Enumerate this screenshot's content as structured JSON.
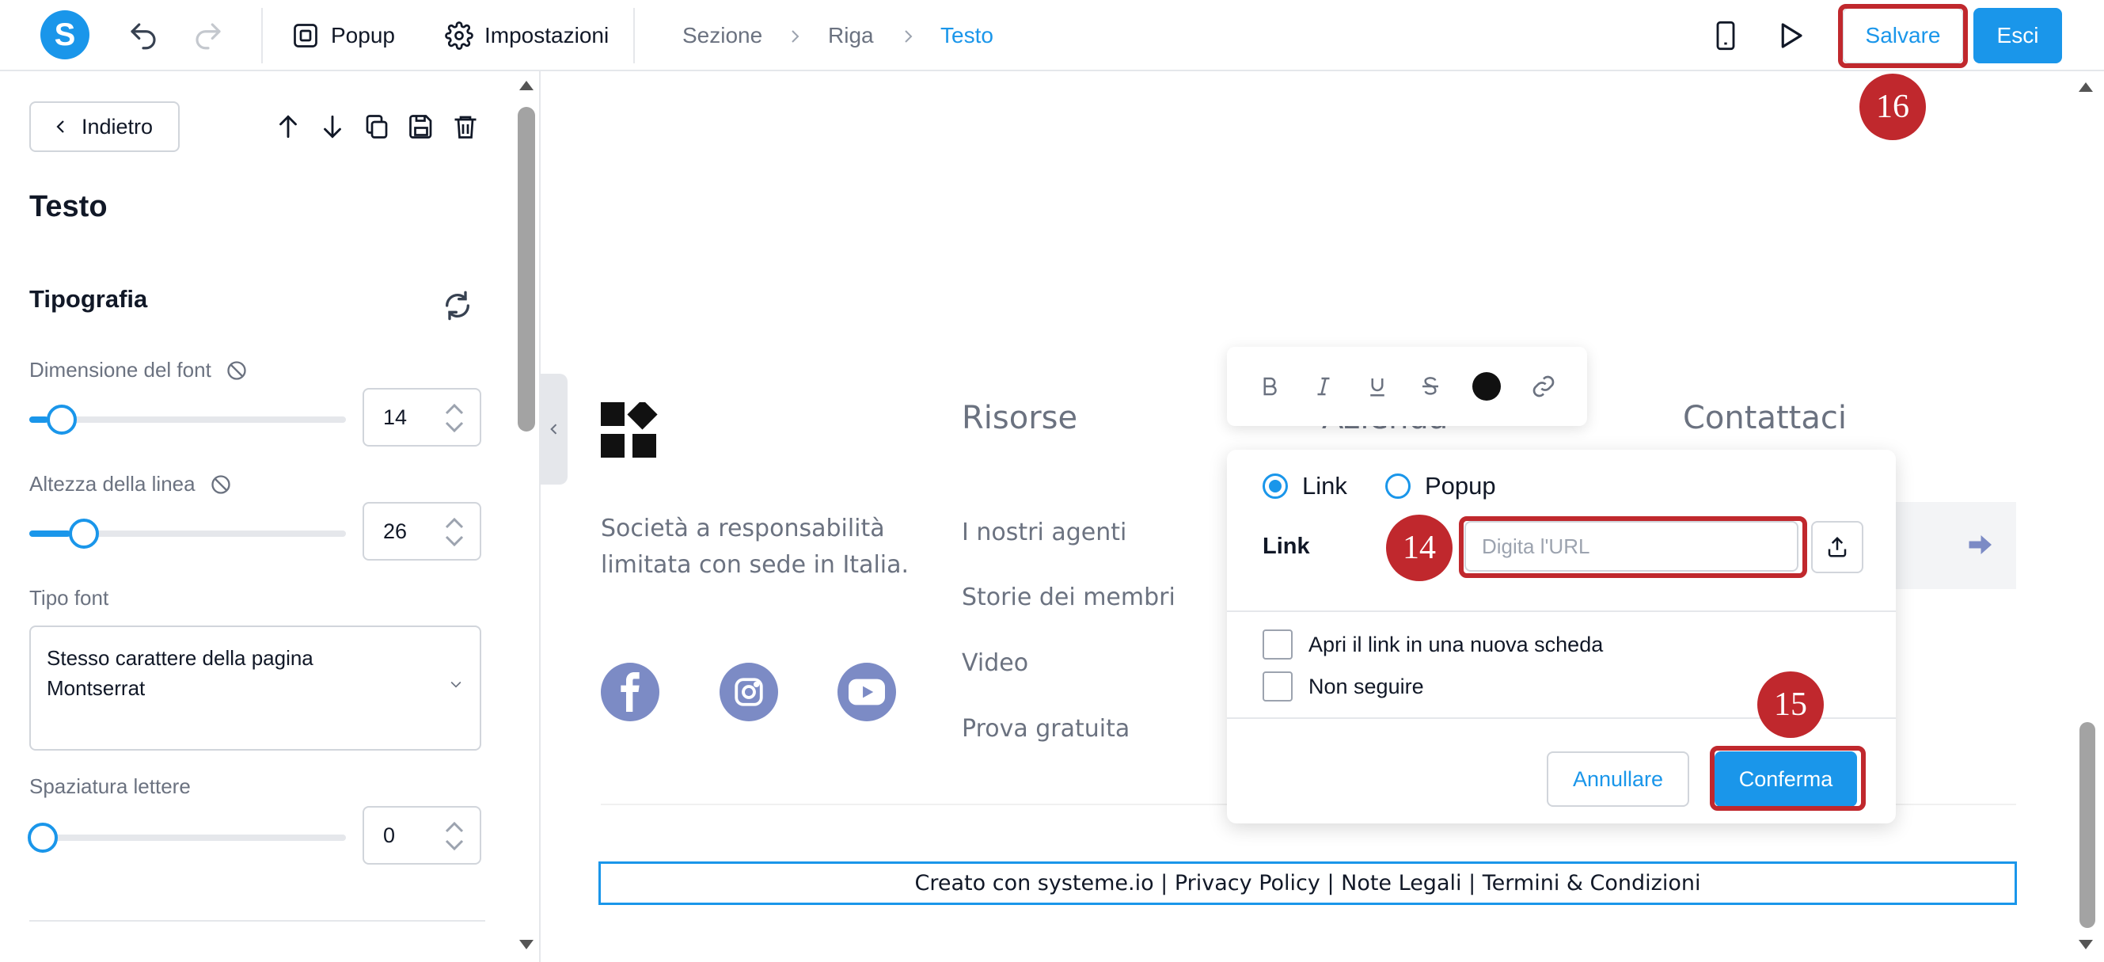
{
  "topbar": {
    "logo_letter": "S",
    "popup_label": "Popup",
    "settings_label": "Impostazioni",
    "breadcrumb": [
      "Sezione",
      "Riga",
      "Testo"
    ],
    "save_label": "Salvare",
    "exit_label": "Esci"
  },
  "sidebar": {
    "back_label": "Indietro",
    "title": "Testo",
    "section_title": "Tipografia",
    "font_size_label": "Dimensione del font",
    "font_size_value": "14",
    "font_size_slider_fraction": 0.06,
    "line_height_label": "Altezza della linea",
    "line_height_value": "26",
    "line_height_slider_fraction": 0.13,
    "font_type_label": "Tipo font",
    "font_type_value_line1": "Stesso carattere della pagina",
    "font_type_value_line2": "Montserrat",
    "letter_spacing_label": "Spaziatura lettere",
    "letter_spacing_value": "0",
    "letter_spacing_slider_fraction": 0.0
  },
  "canvas": {
    "company_text": "Società a responsabilità limitata con sede in Italia.",
    "col_risorse": "Risorse",
    "col_azienda": "Azienda",
    "col_contattaci": "Contattaci",
    "risorse_links": [
      "I nostri agenti",
      "Storie dei membri",
      "Video",
      "Prova gratuita"
    ],
    "credits": "Creato con systeme.io | Privacy Policy | Note Legali | Termini & Condizioni"
  },
  "link_popup": {
    "radio_link": "Link",
    "radio_popup": "Popup",
    "link_label": "Link",
    "url_placeholder": "Digita l'URL",
    "new_tab_label": "Apri il link in una nuova scheda",
    "nofollow_label": "Non seguire",
    "cancel_label": "Annullare",
    "confirm_label": "Conferma"
  },
  "annotations": {
    "badge_14": "14",
    "badge_15": "15",
    "badge_16": "16",
    "highlight_color": "#c0282d"
  },
  "colors": {
    "accent": "#1a96ea",
    "social": "#7c8bc5"
  }
}
